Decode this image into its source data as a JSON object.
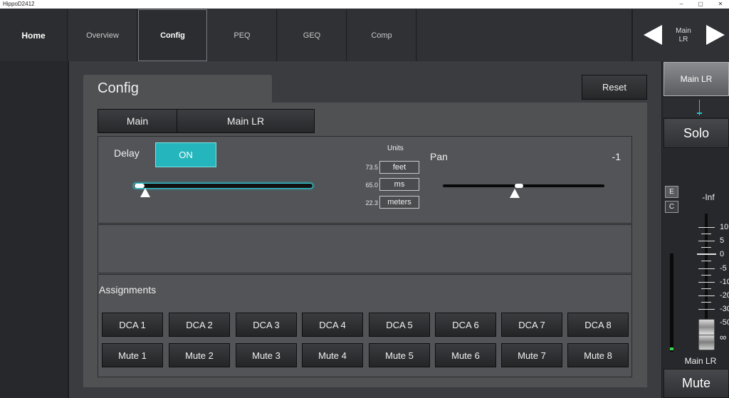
{
  "window": {
    "title": "HippoD2412",
    "min": "–",
    "max": "▢",
    "close": "✕"
  },
  "topnav": {
    "home": "Home",
    "tabs": [
      "Overview",
      "Config",
      "PEQ",
      "GEQ",
      "Comp"
    ],
    "active_tab": "Config",
    "channel_label": "Main LR",
    "prev_icon": "triangle-left",
    "next_icon": "triangle-right"
  },
  "config": {
    "title": "Config",
    "reset_label": "Reset",
    "selector": {
      "group": "Main",
      "channel": "Main LR"
    },
    "delay": {
      "label": "Delay",
      "toggle_label": "ON",
      "enabled": true,
      "slider_level": 0.0
    },
    "units": {
      "title": "Units",
      "rows": [
        {
          "value": "73.5",
          "unit": "feet"
        },
        {
          "value": "65.0",
          "unit": "ms"
        },
        {
          "value": "22.3",
          "unit": "meters"
        }
      ]
    },
    "pan": {
      "label": "Pan",
      "value": "-1",
      "position": -0.01
    },
    "assignments": {
      "title": "Assignments",
      "dca": [
        "DCA 1",
        "DCA 2",
        "DCA 3",
        "DCA 4",
        "DCA 5",
        "DCA 6",
        "DCA 7",
        "DCA 8"
      ],
      "mute": [
        "Mute 1",
        "Mute 2",
        "Mute 3",
        "Mute 4",
        "Mute 5",
        "Mute 6",
        "Mute 7",
        "Mute 8"
      ]
    }
  },
  "channel_strip": {
    "name_button": "Main LR",
    "solo_label": "Solo",
    "e_label": "E",
    "c_label": "C",
    "level_readout": "-Inf",
    "scale": [
      "10",
      "5",
      "0",
      "-5",
      "-10",
      "-20",
      "-30",
      "-50",
      "∞"
    ],
    "fader_name": "Main LR",
    "mute_label": "Mute",
    "accent": "#28c4cb",
    "meter_color": "#39d34a"
  }
}
